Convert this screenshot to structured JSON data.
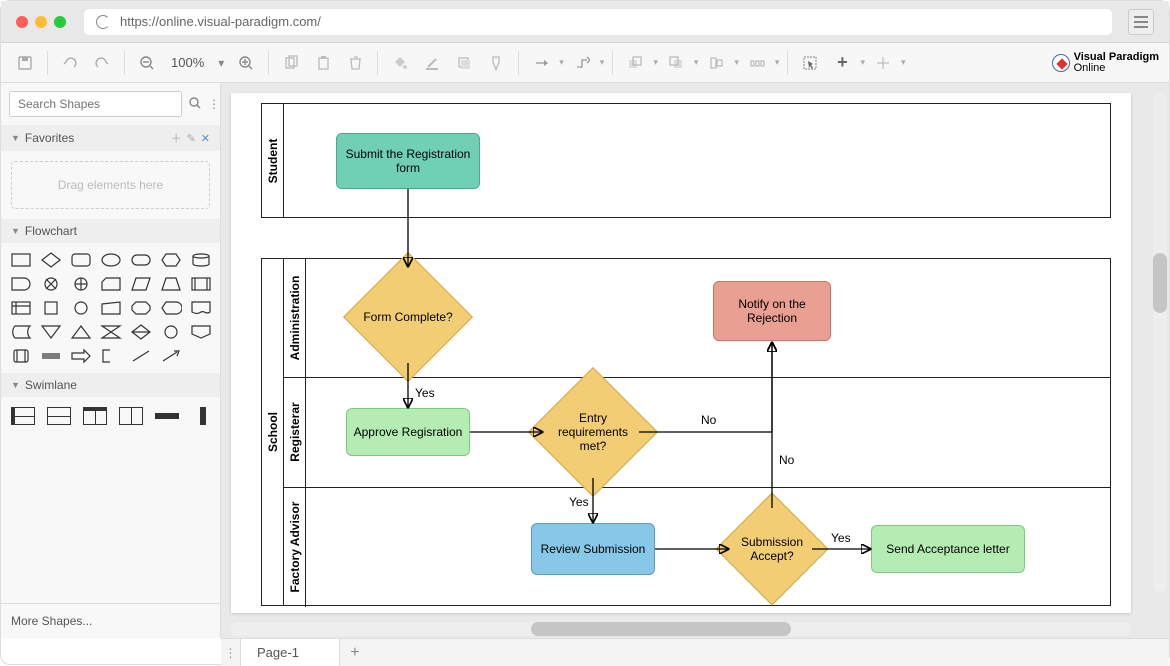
{
  "url": "https://online.visual-paradigm.com/",
  "brand": {
    "name": "Visual Paradigm",
    "sub": "Online"
  },
  "toolbar": {
    "zoom_label": "100%"
  },
  "sidebar": {
    "search_placeholder": "Search Shapes",
    "favorites_label": "Favorites",
    "dropzone_label": "Drag elements here",
    "flowchart_label": "Flowchart",
    "swimlane_label": "Swimlane",
    "more_shapes_label": "More Shapes..."
  },
  "footer": {
    "page_label": "Page-1"
  },
  "diagram": {
    "pools": {
      "student": {
        "title": "Student"
      },
      "school": {
        "title": "School",
        "lanes": {
          "admin": "Administration",
          "registrar": "Registerar",
          "advisor": "Factory Advisor"
        }
      }
    },
    "nodes": {
      "submit": "Submit the Registration form",
      "form_complete": "Form Complete?",
      "approve": "Approve Regisration",
      "entry_met": "Entry requirements met?",
      "notify_reject": "Notify on the Rejection",
      "review": "Review Submission",
      "sub_accept": "Submission Accept?",
      "send_letter": "Send Acceptance letter"
    },
    "edges": {
      "yes": "Yes",
      "no": "No"
    }
  }
}
